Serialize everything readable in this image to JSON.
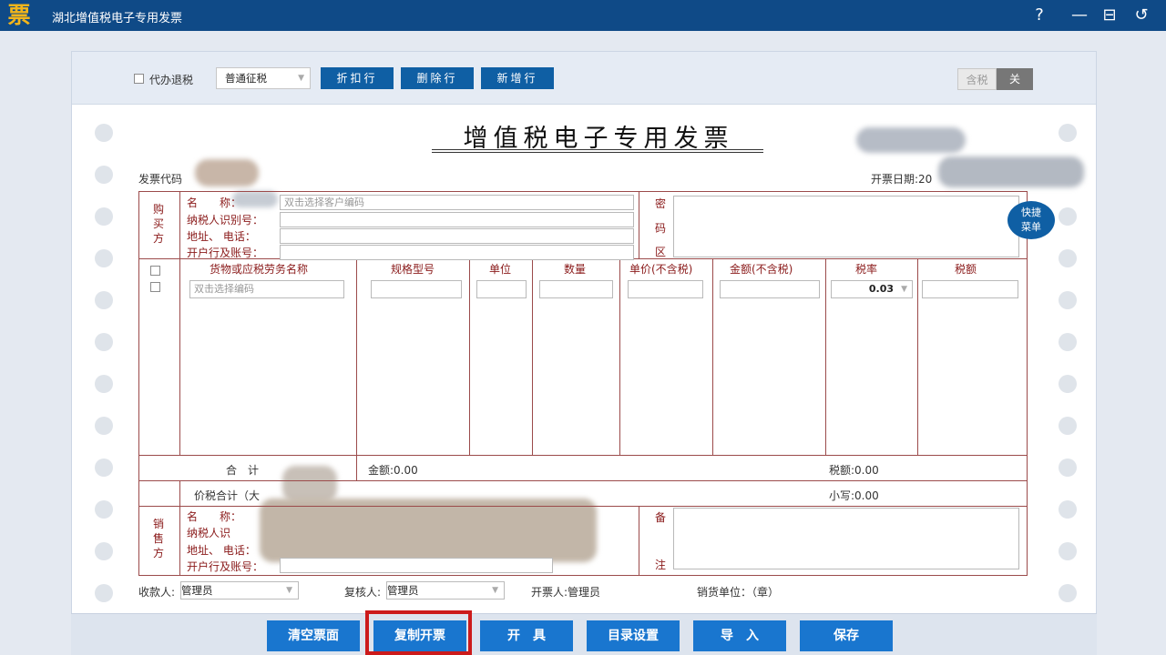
{
  "titlebar": {
    "logo_glyph": "票",
    "title": "湖北增值税电子专用发票",
    "help": "?",
    "minimize": "—",
    "restore": "⊟",
    "back": "↺"
  },
  "toolbar": {
    "agent_refund_label": "代办退税",
    "levy_type": "普通征税",
    "btn_discount": "折扣行",
    "btn_delete": "删除行",
    "btn_add": "新增行",
    "tax_incl_label": "含税",
    "tax_incl_state": "关"
  },
  "invoice": {
    "title": "增值税电子专用发票",
    "code_label": "发票代码",
    "date_label": "开票日期:20",
    "buyer": {
      "side_label": "购\n买\n方",
      "name_label": "名　　称：",
      "name_placeholder": "双击选择客户编码",
      "tax_id_label": "纳税人识别号：",
      "address_label": "地址、 电话：",
      "bank_label": "开户行及账号："
    },
    "cipher": {
      "c1": "密",
      "c2": "码",
      "c3": "区"
    },
    "items": {
      "columns": [
        "货物或应税劳务名称",
        "规格型号",
        "单位",
        "数量",
        "单价(不含税)",
        "金额(不含税)",
        "税率",
        "税额"
      ],
      "name_placeholder": "双击选择编码",
      "tax_rate": "0.03"
    },
    "total": {
      "label": "合　计",
      "amount": "金额:0.00",
      "tax": "税额:0.00"
    },
    "grand_total": {
      "label": "价税合计（大",
      "small": "小写:0.00"
    },
    "seller": {
      "side_label": "销\n售\n方",
      "name_label": "名　　称：",
      "tax_id_label": "纳税人识",
      "address_label": "地址、 电话：",
      "bank_label": "开户行及账号："
    },
    "remark": {
      "r1": "备",
      "r2": "注"
    },
    "footer": {
      "payee_label": "收款人:",
      "payee": "管理员",
      "reviewer_label": "复核人:",
      "reviewer": "管理员",
      "drawer": "开票人:管理员",
      "seller_seal": "销货单位：（章）"
    }
  },
  "quick_menu": "快捷\n菜单",
  "actions": {
    "clear": "清空票面",
    "copy": "复制开票",
    "issue": "开　具",
    "catalog": "目录设置",
    "import": "导　入",
    "save": "保存"
  },
  "colors": {
    "titlebar": "#0f4a87",
    "button": "#1976cf",
    "highlight": "#cc1b1b",
    "grid_line": "#9b4a4a"
  }
}
